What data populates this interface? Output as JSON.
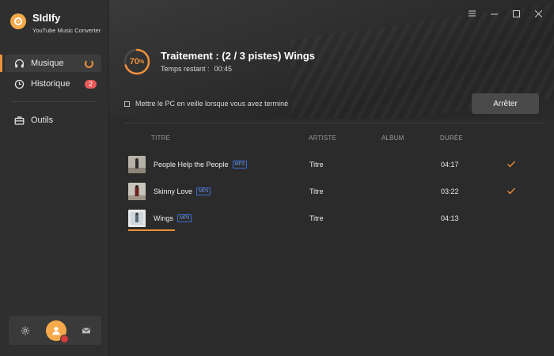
{
  "app": {
    "name": "SIdIfy",
    "subtitle": "YouTube Music Converter"
  },
  "sidebar": {
    "items": [
      {
        "label": "Musique",
        "icon": "headphones-icon",
        "active": true,
        "status": "converting"
      },
      {
        "label": "Historique",
        "icon": "clock-icon",
        "badge": "2"
      },
      {
        "label": "Outils",
        "icon": "toolbox-icon"
      }
    ],
    "bottom": {
      "settings_icon": "gear-icon",
      "avatar_icon": "user-avatar",
      "mail_icon": "mail-icon"
    }
  },
  "window_controls": [
    "menu-icon",
    "minimize-icon",
    "maximize-icon",
    "close-icon"
  ],
  "conversion": {
    "progress_percent": 70,
    "progress_value": "70",
    "progress_unit": "%",
    "title": "Traitement : (2 / 3 pistes) Wings",
    "time_label": "Temps restant :",
    "time_value": "00:45",
    "sleep_label": "Mettre le PC en veille lorsque vous avez terminé",
    "sleep_checked": false,
    "stop_label": "Arrêter"
  },
  "table": {
    "headers": {
      "title": "TITRE",
      "artist": "ARTISTE",
      "album": "ALBUM",
      "duration": "DURÉE"
    },
    "rows": [
      {
        "title": "People Help the People",
        "format": "MP3",
        "artist": "Titre",
        "album": "",
        "duration": "04:17",
        "done": true,
        "progress": 1.0
      },
      {
        "title": "Skinny Love",
        "format": "MP3",
        "artist": "Titre",
        "album": "",
        "duration": "03:22",
        "done": true,
        "progress": 1.0
      },
      {
        "title": "Wings",
        "format": "MP3",
        "artist": "Titre",
        "album": "",
        "duration": "04:13",
        "done": false,
        "progress": 0.7
      }
    ]
  },
  "colors": {
    "accent": "#f0903a",
    "badge": "#e85a5a",
    "format_tag": "#3b6fd6",
    "sidebar_bg": "#2f2f2f",
    "main_bg": "#2b2b2b"
  }
}
